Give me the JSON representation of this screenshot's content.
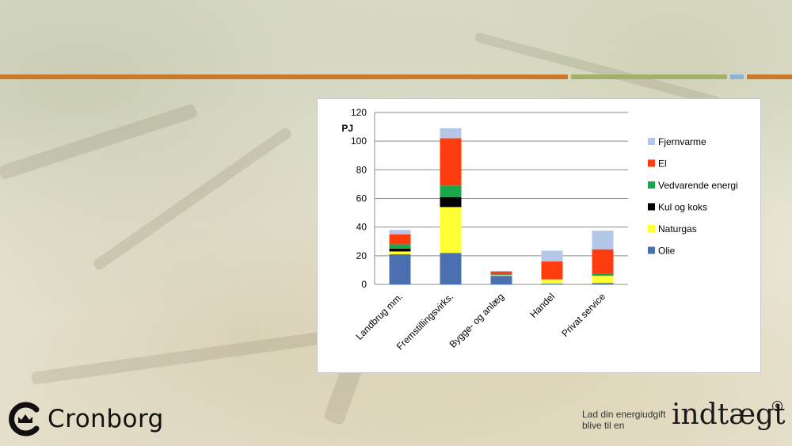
{
  "colors": {
    "stripe_orange": "#c9782c",
    "stripe_green": "#a3b06a",
    "stripe_blue": "#8fb3d6",
    "olie": "#4a70b0",
    "naturgas": "#ffff33",
    "kul_og_koks": "#000000",
    "vedvarende": "#1aa64a",
    "el": "#ff3c0f",
    "fjernvarme": "#b4c7e7"
  },
  "chart_data": {
    "type": "bar",
    "stacked": true,
    "ylabel": "PJ",
    "ylim": [
      0,
      120
    ],
    "yticks": [
      0,
      20,
      40,
      60,
      80,
      100,
      120
    ],
    "grid": true,
    "legend_position": "right",
    "categories": [
      "Landbrug mm.",
      "Fremstillingsvirks.",
      "Bygge- og anlæg",
      "Handel",
      "Privat service"
    ],
    "series": [
      {
        "name": "Olie",
        "color_key": "olie",
        "values": [
          21,
          22,
          6,
          0.5,
          1
        ]
      },
      {
        "name": "Naturgas",
        "color_key": "naturgas",
        "values": [
          2,
          32,
          0.5,
          3,
          5
        ]
      },
      {
        "name": "Kul og koks",
        "color_key": "kul_og_koks",
        "values": [
          2,
          7,
          0,
          0,
          0
        ]
      },
      {
        "name": "Vedvarende energi",
        "color_key": "vedvarende",
        "values": [
          3,
          8,
          0.5,
          0,
          1.5
        ]
      },
      {
        "name": "El",
        "color_key": "el",
        "values": [
          7,
          33,
          2,
          12.5,
          17
        ]
      },
      {
        "name": "Fjernvarme",
        "color_key": "fjernvarme",
        "values": [
          3,
          7,
          0.5,
          7.5,
          13
        ]
      }
    ],
    "legend_order": [
      "Fjernvarme",
      "El",
      "Vedvarende energi",
      "Kul og koks",
      "Naturgas",
      "Olie"
    ]
  },
  "footer": {
    "logo_text": "Cronborg",
    "tagline_line1": "Lad din energiudgift",
    "tagline_line2": "blive til en",
    "brand_word": "indtægt",
    "copyright_mark": "c"
  },
  "icons": {
    "logo": "crown-c-logo-icon"
  }
}
